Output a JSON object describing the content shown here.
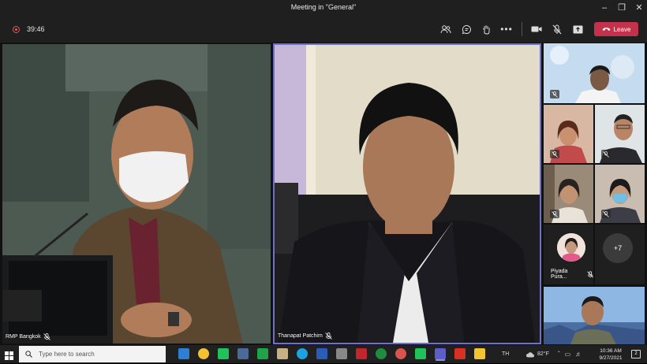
{
  "window": {
    "title": "Meeting in \"General\""
  },
  "toolbar": {
    "timer": "39:46",
    "leave_label": "Leave",
    "accent": "#c4314b"
  },
  "participants": {
    "main_left": {
      "name": "RMP Bangkok"
    },
    "main_right": {
      "name": "Thanapat Patchim"
    },
    "piyada": {
      "name": "Piyada Pura..."
    },
    "overflow": {
      "count": "+7"
    }
  },
  "taskbar": {
    "search_placeholder": "Type here to search",
    "weather": "82°F",
    "language": "TH",
    "time": "10:36 AM",
    "date": "9/27/2021",
    "notifications": "2"
  }
}
